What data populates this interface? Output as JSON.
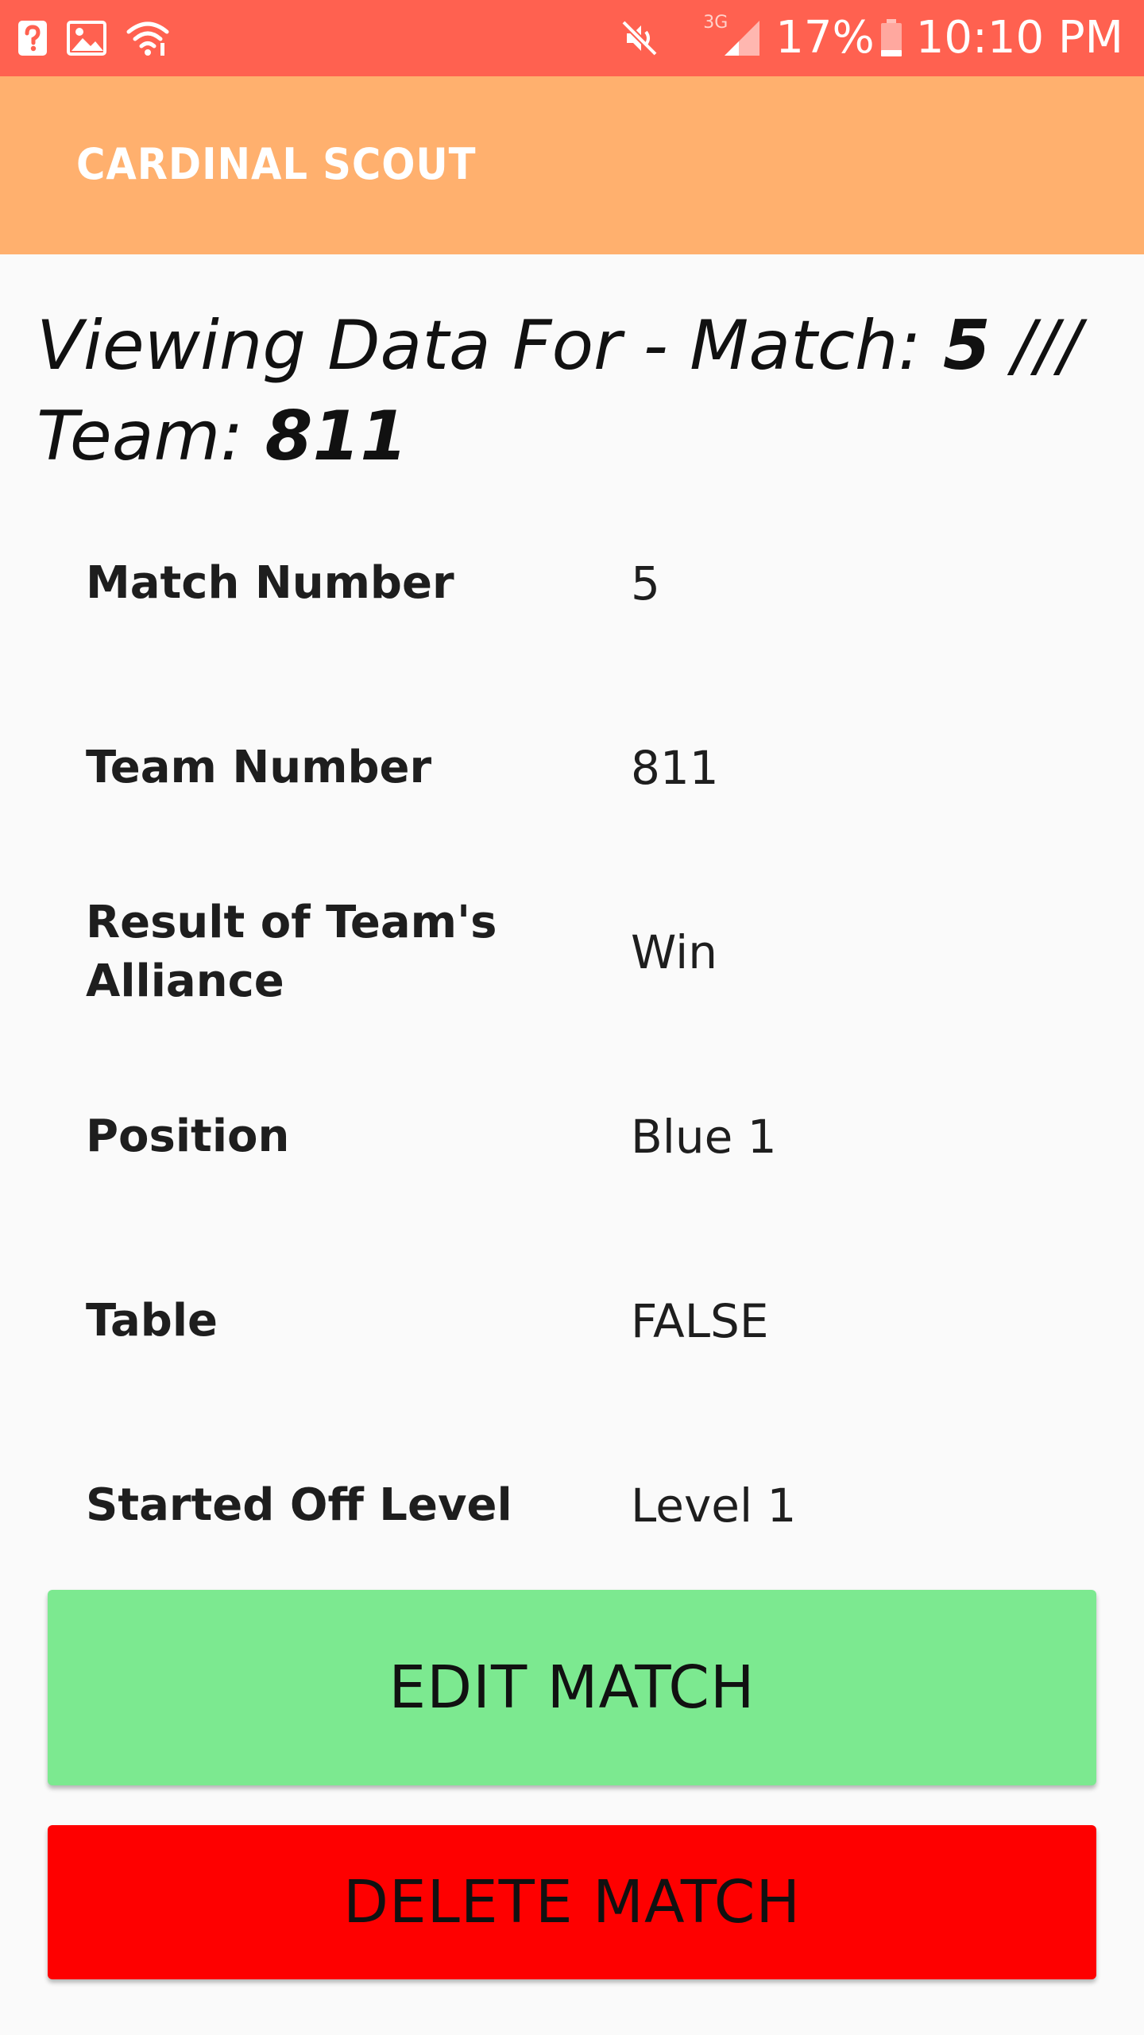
{
  "status_bar": {
    "left_icons": [
      "help-box-icon",
      "image-icon",
      "wifi-icon"
    ],
    "network_label": "3G",
    "battery_percent": "17%",
    "time": "10:10 PM",
    "background": "#ff6150"
  },
  "app_bar": {
    "title": "CARDINAL SCOUT",
    "background": "#ffb06e"
  },
  "heading": {
    "prefix": "Viewing Data For - Match: ",
    "match_number": "5",
    "separator": " /// ",
    "team_prefix": "Team: ",
    "team_number": "811"
  },
  "rows": [
    {
      "label": "Match Number",
      "value": "5"
    },
    {
      "label": "Team Number",
      "value": "811"
    },
    {
      "label": "Result of Team's Alliance",
      "value": "Win"
    },
    {
      "label": "Position",
      "value": "Blue 1"
    },
    {
      "label": "Table",
      "value": "FALSE"
    },
    {
      "label": "Started Off Level",
      "value": "Level 1"
    }
  ],
  "buttons": {
    "edit_label": "EDIT MATCH",
    "delete_label": "DELETE MATCH",
    "edit_color": "#7ce990",
    "delete_color": "#fe0000"
  }
}
